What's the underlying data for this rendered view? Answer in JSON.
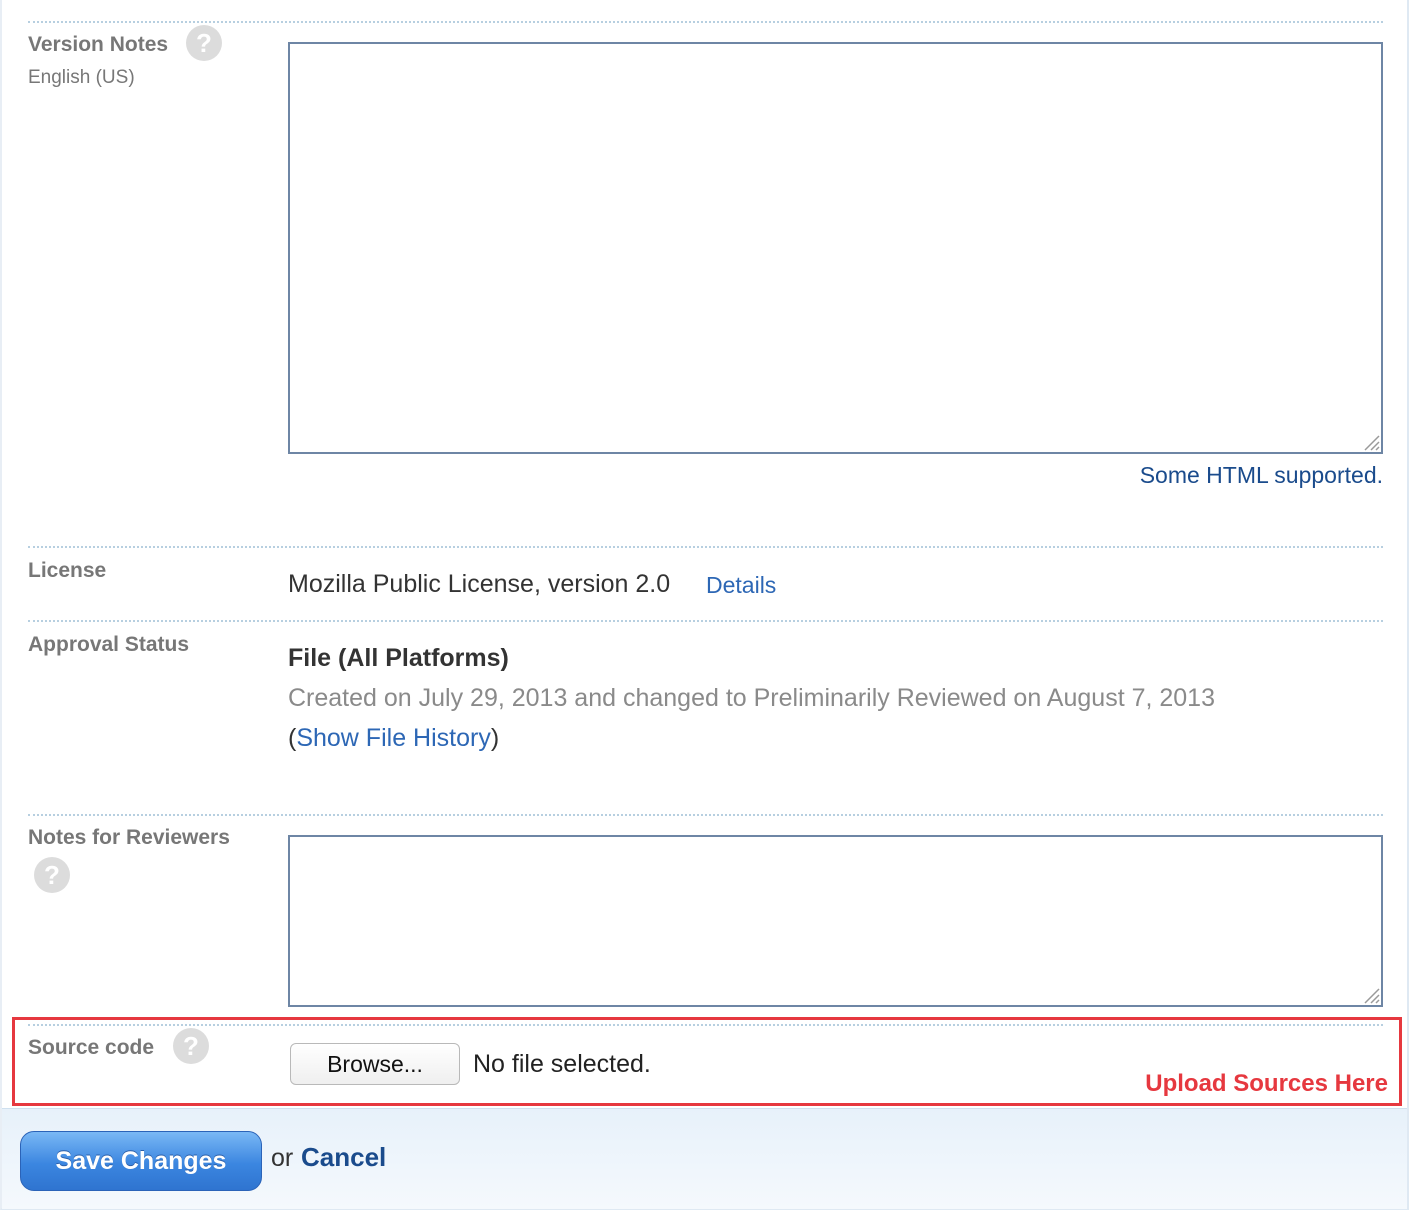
{
  "version_notes": {
    "label": "Version Notes",
    "locale": "English (US)",
    "value": "",
    "html_note": "Some HTML supported."
  },
  "license": {
    "label": "License",
    "value": "Mozilla Public License, version 2.0",
    "details_link": "Details"
  },
  "approval_status": {
    "label": "Approval Status",
    "file_title": "File (All Platforms)",
    "status_text": "Created on July 29, 2013 and changed to Preliminarily Reviewed on August 7, 2013",
    "open_paren": "(",
    "history_link": "Show File History",
    "close_paren": ")"
  },
  "reviewer_notes": {
    "label": "Notes for Reviewers",
    "value": ""
  },
  "source_code": {
    "label": "Source code",
    "browse_label": "Browse...",
    "file_status": "No file selected.",
    "annotation": "Upload Sources Here",
    "annotation_color": "#e6383f"
  },
  "footer": {
    "save_label": "Save Changes",
    "or_text": "or",
    "cancel_label": "Cancel"
  },
  "icons": {
    "help": "question-mark",
    "help_glyph": "?"
  },
  "colors": {
    "link": "#2d67b5",
    "label": "#777777",
    "save_button": "#3b86e0"
  }
}
